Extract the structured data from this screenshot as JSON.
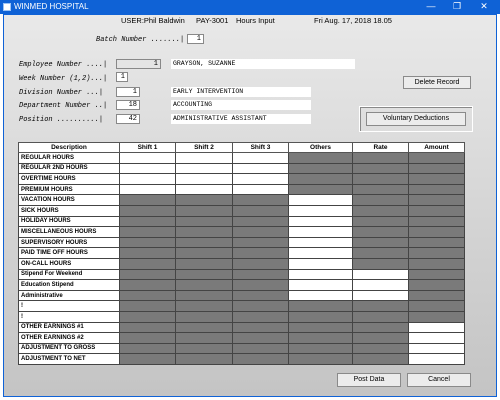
{
  "window": {
    "title": "WINMED HOSPITAL",
    "minimize": "—",
    "maximize": "❐",
    "close": "✕"
  },
  "header": {
    "user": "USER:Phil Baldwin",
    "pay_code": "PAY-3001",
    "screen": "Hours Input",
    "datetime": "Fri Aug. 17, 2018 18.05"
  },
  "batch": {
    "label": "Batch Number .......|",
    "value": "1"
  },
  "employee": {
    "label": "Employee Number ....|",
    "number": "1",
    "name": "GRAYSON, SUZANNE"
  },
  "week": {
    "label": "Week Number (1,2)...|",
    "value": "1"
  },
  "division": {
    "label": "Division Number ...|",
    "number": "1",
    "name": "EARLY INTERVENTION"
  },
  "department": {
    "label": "Department Number ..|",
    "number": "18",
    "name": "ACCOUNTING"
  },
  "position": {
    "label": "Position ..........|",
    "number": "42",
    "name": "ADMINISTRATIVE ASSISTANT"
  },
  "buttons": {
    "delete_record": "Delete Record",
    "voluntary_deductions": "Voluntary Deductions",
    "post_data": "Post Data",
    "cancel": "Cancel"
  },
  "grid": {
    "columns": [
      "Description",
      "Shift 1",
      "Shift 2",
      "Shift 3",
      "Others",
      "Rate",
      "Amount"
    ],
    "rows": [
      {
        "label": "REGULAR HOURS",
        "cells": [
          "w",
          "w",
          "w",
          "d",
          "d",
          "d"
        ]
      },
      {
        "label": "REGULAR 2ND HOURS",
        "cells": [
          "w",
          "w",
          "w",
          "d",
          "d",
          "d"
        ]
      },
      {
        "label": "OVERTIME HOURS",
        "cells": [
          "w",
          "w",
          "w",
          "d",
          "d",
          "d"
        ]
      },
      {
        "label": "PREMIUM HOURS",
        "cells": [
          "w",
          "w",
          "w",
          "d",
          "d",
          "d"
        ]
      },
      {
        "label": "VACATION HOURS",
        "cells": [
          "d",
          "d",
          "d",
          "w",
          "d",
          "d"
        ]
      },
      {
        "label": "SICK HOURS",
        "cells": [
          "d",
          "d",
          "d",
          "w",
          "d",
          "d"
        ]
      },
      {
        "label": "HOLIDAY HOURS",
        "cells": [
          "d",
          "d",
          "d",
          "w",
          "d",
          "d"
        ]
      },
      {
        "label": "MISCELLANEOUS HOURS",
        "cells": [
          "d",
          "d",
          "d",
          "w",
          "d",
          "d"
        ]
      },
      {
        "label": "SUPERVISORY HOURS",
        "cells": [
          "d",
          "d",
          "d",
          "w",
          "d",
          "d"
        ]
      },
      {
        "label": "PAID TIME OFF HOURS",
        "cells": [
          "d",
          "d",
          "d",
          "w",
          "d",
          "d"
        ]
      },
      {
        "label": "ON-CALL HOURS",
        "cells": [
          "d",
          "d",
          "d",
          "w",
          "d",
          "d"
        ]
      },
      {
        "label": "Stipend For Weekend",
        "cells": [
          "d",
          "d",
          "d",
          "w",
          "w",
          "d"
        ]
      },
      {
        "label": "Education Stipend",
        "cells": [
          "d",
          "d",
          "d",
          "w",
          "w",
          "d"
        ]
      },
      {
        "label": "Administrative",
        "cells": [
          "d",
          "d",
          "d",
          "w",
          "w",
          "d"
        ]
      },
      {
        "label": "!",
        "cells": [
          "d",
          "d",
          "d",
          "d",
          "d",
          "d"
        ]
      },
      {
        "label": "!",
        "cells": [
          "d",
          "d",
          "d",
          "d",
          "d",
          "d"
        ]
      },
      {
        "label": "OTHER EARNINGS #1",
        "cells": [
          "d",
          "d",
          "d",
          "d",
          "d",
          "w"
        ]
      },
      {
        "label": "OTHER EARNINGS #2",
        "cells": [
          "d",
          "d",
          "d",
          "d",
          "d",
          "w"
        ]
      },
      {
        "label": "ADJUSTMENT TO GROSS",
        "cells": [
          "d",
          "d",
          "d",
          "d",
          "d",
          "w"
        ]
      },
      {
        "label": "ADJUSTMENT TO NET",
        "cells": [
          "d",
          "d",
          "d",
          "d",
          "d",
          "w"
        ]
      }
    ]
  }
}
